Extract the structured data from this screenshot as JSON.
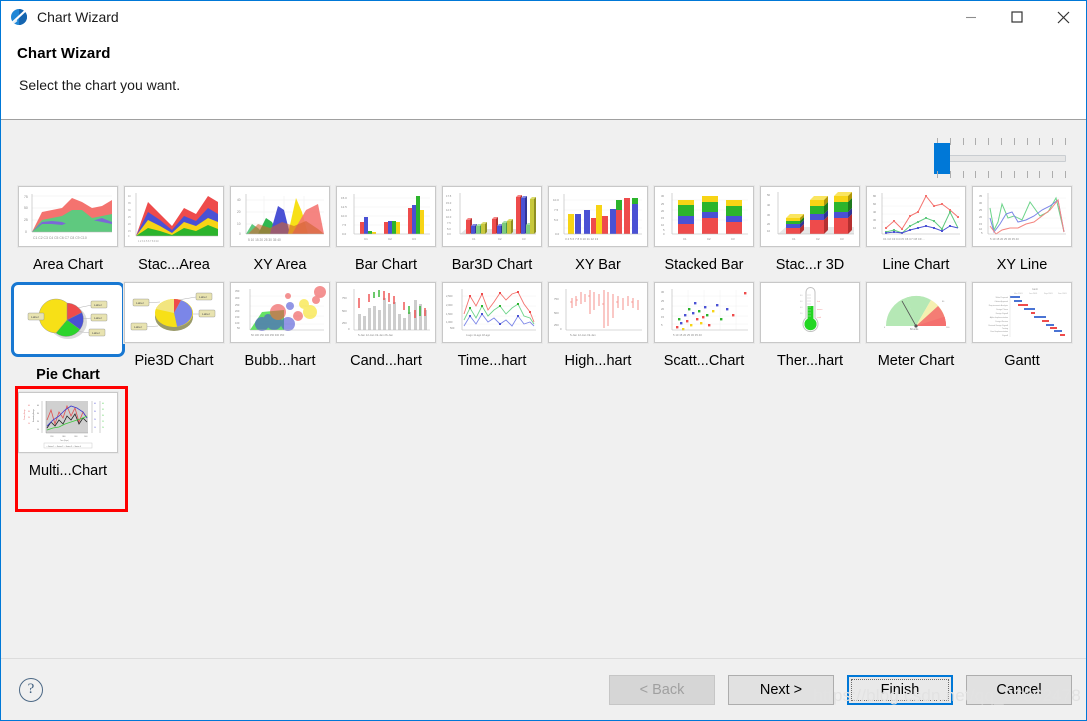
{
  "window": {
    "title": "Chart Wizard",
    "icon": "chart-wizard-icon",
    "controls": {
      "minimize": "minimize-icon",
      "maximize": "maximize-icon",
      "close": "close-icon"
    }
  },
  "header": {
    "title": "Chart Wizard",
    "description": "Select the chart you want."
  },
  "slider": {
    "name": "preview-size-slider",
    "value": 0,
    "ticks": 11
  },
  "gallery": {
    "selected": "Pie Chart",
    "items": [
      {
        "label": "Area Chart",
        "thumb": "area-chart-thumb"
      },
      {
        "label": "Stac...Area",
        "thumb": "stacked-area-chart-thumb"
      },
      {
        "label": "XY Area",
        "thumb": "xy-area-chart-thumb"
      },
      {
        "label": "Bar Chart",
        "thumb": "bar-chart-thumb"
      },
      {
        "label": "Bar3D Chart",
        "thumb": "bar3d-chart-thumb"
      },
      {
        "label": "XY Bar",
        "thumb": "xy-bar-chart-thumb"
      },
      {
        "label": "Stacked Bar",
        "thumb": "stacked-bar-chart-thumb"
      },
      {
        "label": "Stac...r 3D",
        "thumb": "stacked-bar3d-chart-thumb"
      },
      {
        "label": "Line Chart",
        "thumb": "line-chart-thumb"
      },
      {
        "label": "XY Line",
        "thumb": "xy-line-chart-thumb"
      },
      {
        "label": "Pie Chart",
        "thumb": "pie-chart-thumb"
      },
      {
        "label": "Pie3D Chart",
        "thumb": "pie3d-chart-thumb"
      },
      {
        "label": "Bubb...hart",
        "thumb": "bubble-chart-thumb"
      },
      {
        "label": "Cand...hart",
        "thumb": "candlestick-chart-thumb"
      },
      {
        "label": "Time...hart",
        "thumb": "timeseries-chart-thumb"
      },
      {
        "label": "High...hart",
        "thumb": "highlow-chart-thumb"
      },
      {
        "label": "Scatt...Chart",
        "thumb": "scatter-chart-thumb"
      },
      {
        "label": "Ther...hart",
        "thumb": "thermometer-chart-thumb"
      },
      {
        "label": "Meter Chart",
        "thumb": "meter-chart-thumb"
      },
      {
        "label": "Gantt",
        "thumb": "gantt-chart-thumb"
      },
      {
        "label": "Multi...Chart",
        "thumb": "multiaxis-chart-thumb"
      }
    ]
  },
  "footer": {
    "help": "?",
    "buttons": {
      "back": "< Back",
      "next": "Next >",
      "finish": "Finish",
      "cancel": "Cancel"
    }
  },
  "watermark": "https://blog.csdn.net/qq_36662478",
  "colors": {
    "accent": "#0078d7",
    "selection_border": "#1878d2",
    "annotation": "#fe0000",
    "header_bg": "#ffffff",
    "body_bg": "#f0f0f0"
  }
}
